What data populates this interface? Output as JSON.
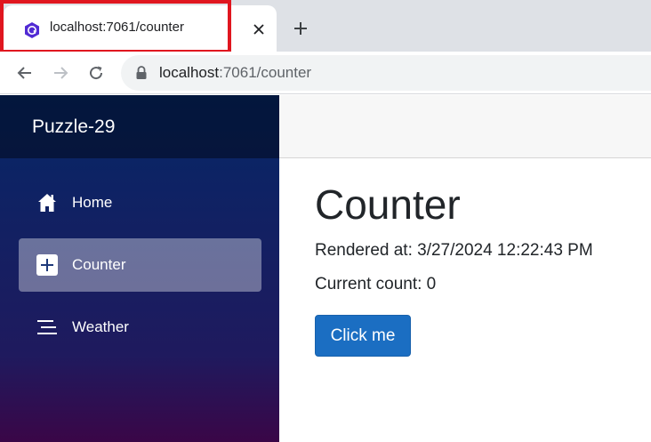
{
  "browser": {
    "tab_title": "localhost:7061/counter",
    "url_host": "localhost",
    "url_path": ":7061/counter",
    "icons": {
      "favicon": "blazor-icon",
      "close": "close-icon",
      "new_tab": "plus-icon",
      "back": "back-arrow-icon",
      "forward": "forward-arrow-icon",
      "reload": "reload-icon",
      "lock": "lock-icon"
    }
  },
  "sidebar": {
    "brand": "Puzzle-29",
    "items": [
      {
        "label": "Home",
        "icon": "home-icon",
        "active": false
      },
      {
        "label": "Counter",
        "icon": "plus-square-icon",
        "active": true
      },
      {
        "label": "Weather",
        "icon": "list-icon",
        "active": false
      }
    ]
  },
  "main": {
    "title": "Counter",
    "rendered_at": "Rendered at: 3/27/2024 12:22:43 PM",
    "current_count": "Current count: 0",
    "button_label": "Click me"
  },
  "colors": {
    "highlight_border": "#e0161f",
    "button_bg": "#1b6ec2",
    "sidebar_top": "#052767",
    "sidebar_bottom": "#3a0647"
  }
}
